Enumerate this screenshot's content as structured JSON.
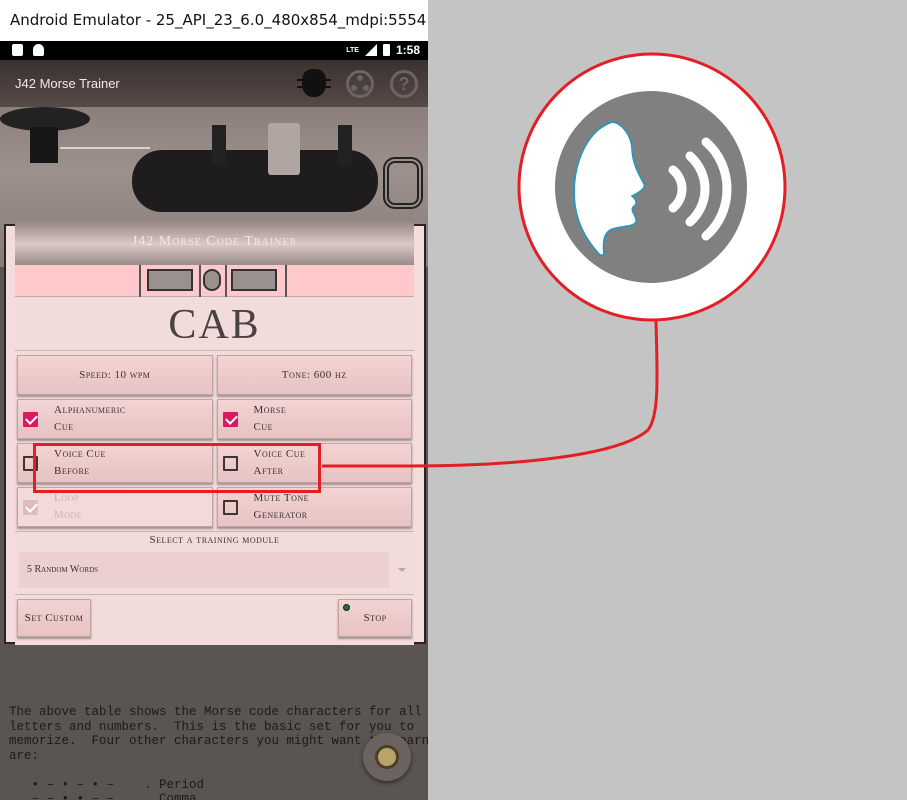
{
  "emulator": {
    "title": "Android Emulator - 25_API_23_6.0_480x854_mdpi:5554"
  },
  "status_bar": {
    "network": "LTE",
    "time": "1:58"
  },
  "action_bar": {
    "title": "J42 Morse Trainer",
    "help_glyph": "?"
  },
  "panel": {
    "header": "J42 Morse Code Trainer",
    "display_word": "CAB",
    "speed_button": "Speed: 10 wpm",
    "tone_button": "Tone: 600 hz",
    "options": [
      {
        "label": "Alphanumeric\nCue",
        "checked": true,
        "enabled": true
      },
      {
        "label": "Morse\nCue",
        "checked": true,
        "enabled": true
      },
      {
        "label": "Voice Cue\nBefore",
        "checked": false,
        "enabled": true
      },
      {
        "label": "Voice Cue\nAfter",
        "checked": false,
        "enabled": true
      },
      {
        "label": "Loop\nMode",
        "checked": true,
        "enabled": false
      },
      {
        "label": "Mute Tone\nGenerator",
        "checked": false,
        "enabled": true
      }
    ],
    "module_label": "Select a training module",
    "module_value": "5 Random Words",
    "set_custom_button": "Set Custom",
    "stop_button": "Stop"
  },
  "reference_text": {
    "body": "The above table shows the Morse code characters for all\nletters and numbers.  This is the basic set for you to\nmemorize.  Four other characters you might want to learn\nare:\n\n   • – • – • –    . Period\n   – – • • – –    , Comma"
  },
  "annotation": {
    "accent_color": "#e41e25",
    "icon": "voice-speaking-icon"
  }
}
